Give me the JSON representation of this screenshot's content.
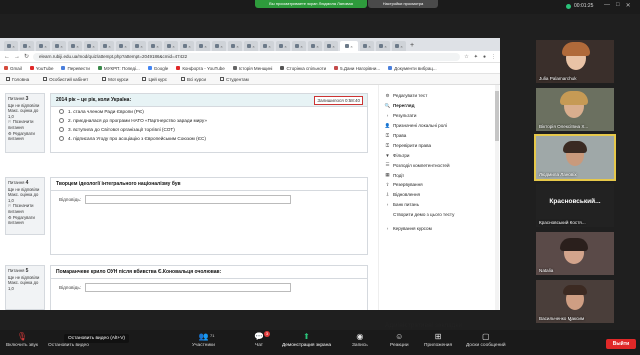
{
  "zoom_top": {
    "share_status": "Вы просматриваете экран Людмила Лановая",
    "view_settings": "Настройки просмотра",
    "timer": "00:01:25"
  },
  "browser": {
    "url": "elearn.rubiji.edu.ua/mod/quiz/attempt.php?attempt=2049186&cmid=47422",
    "bookmarks": [
      {
        "label": "Gmail",
        "color": "#d54b3d"
      },
      {
        "label": "YouTube",
        "color": "#e02828"
      },
      {
        "label": "Перевести",
        "color": "#4a7fdc"
      },
      {
        "label": "МУКРП: Попеді...",
        "color": "#3a8a4a"
      },
      {
        "label": "Google",
        "color": "#4285f4"
      },
      {
        "label": "Конфорта - YouTube",
        "color": "#e02828"
      },
      {
        "label": "Історія Менщині",
        "color": "#666666"
      },
      {
        "label": "Сторінка спільноти",
        "color": "#555555"
      },
      {
        "label": "5.Дани Нагорівни...",
        "color": "#c44a4a"
      },
      {
        "label": "Документи вибрац...",
        "color": "#4a7fdc"
      }
    ],
    "site_nav": [
      "Головна",
      "Особистий кабінет",
      "Мої курси",
      "Цей курс",
      "Всі курси",
      "Студентам"
    ]
  },
  "questions": [
    {
      "num": "3",
      "state": "Ще не відповіли",
      "mark": "Макс. оцінка до 1,0",
      "flag": "Позначити питання",
      "text": "2014 рік – це рік, коли Україна:",
      "timer": "Залишилося 0:58:40",
      "options": [
        "1.   стала членом Ради Європи (РЄ)",
        "2.   приєдналася до програми НАТО «Партнерство заради миру»",
        "3.   вступила до Світової організації торгівлі (СОТ)",
        "4.   підписала Угоду про асоціацію з Європейським Союзом (ЄС)"
      ]
    },
    {
      "num": "4",
      "state": "Ще не відповіли",
      "mark": "Макс. оцінка до 1,0",
      "flag": "Позначити питання",
      "text": "Творцем ідеології інтегрального націоналізму був",
      "answer_label": "Відповідь:"
    },
    {
      "num": "5",
      "state": "Ще не відповіли",
      "mark": "Макс. оцінка до 1,0",
      "text": "Помаранчеве крило ОУН після вбивства Є.Коновальця очолював:",
      "answer_label": "Відповідь:"
    }
  ],
  "admin": {
    "items": [
      {
        "label": "Редагувати тест",
        "icon": "gear-icon",
        "glyph": "⚙",
        "bold": false,
        "sub": false
      },
      {
        "label": "Перегляд",
        "icon": "magnifier-icon",
        "glyph": "🔍",
        "bold": true,
        "sub": false
      },
      {
        "label": "Результати",
        "icon": "chevron-right-icon",
        "glyph": "›",
        "bold": false,
        "sub": false
      },
      {
        "label": "Призначені локальні ролі",
        "icon": "user-icon",
        "glyph": "👤",
        "bold": false,
        "sub": false
      },
      {
        "label": "Права",
        "icon": "key-icon",
        "glyph": "⚿",
        "bold": false,
        "sub": false
      },
      {
        "label": "Перевірити права",
        "icon": "key-icon",
        "glyph": "⚿",
        "bold": false,
        "sub": false
      },
      {
        "label": "Фільтри",
        "icon": "filter-icon",
        "glyph": "▼",
        "bold": false,
        "sub": false
      },
      {
        "label": "Розподіл компетентностей",
        "icon": "list-icon",
        "glyph": "☰",
        "bold": false,
        "sub": false
      },
      {
        "label": "Події",
        "icon": "calendar-icon",
        "glyph": "▦",
        "bold": false,
        "sub": false
      },
      {
        "label": "Резервування",
        "icon": "upload-icon",
        "glyph": "⇧",
        "bold": false,
        "sub": false
      },
      {
        "label": "Відновлення",
        "icon": "download-icon",
        "glyph": "⇩",
        "bold": false,
        "sub": false
      },
      {
        "label": "Банк питань",
        "icon": "chevron-right-icon",
        "glyph": "›",
        "bold": false,
        "sub": false
      },
      {
        "label": "Створити демо з цього тесту",
        "icon": "",
        "glyph": "",
        "bold": false,
        "sub": true
      }
    ],
    "course_admin": "Керування курсом",
    "section_title": "Адміністративні закладки"
  },
  "participants": [
    {
      "name": "Julia Palamarchuk"
    },
    {
      "name": "Вікторія Олексіївна Х..."
    },
    {
      "name": "Людмила Лановіх"
    },
    {
      "name": "Красновський Костя...",
      "big": "Красновський..."
    },
    {
      "name": "Natalia"
    },
    {
      "name": "Васильченко Максим"
    }
  ],
  "toolbar": {
    "mute": "Включить звук",
    "video": "Остановить видео",
    "tooltip": "Остановить видео (Alt+V)",
    "participants": "Участники",
    "participants_count": "71",
    "chat": "Чат",
    "chat_badge": "3",
    "share": "Демонстрация экрана",
    "record": "Запись",
    "reactions": "Реакции",
    "apps": "Приложения",
    "whiteboard": "Доски сообщений",
    "leave": "Выйти"
  }
}
